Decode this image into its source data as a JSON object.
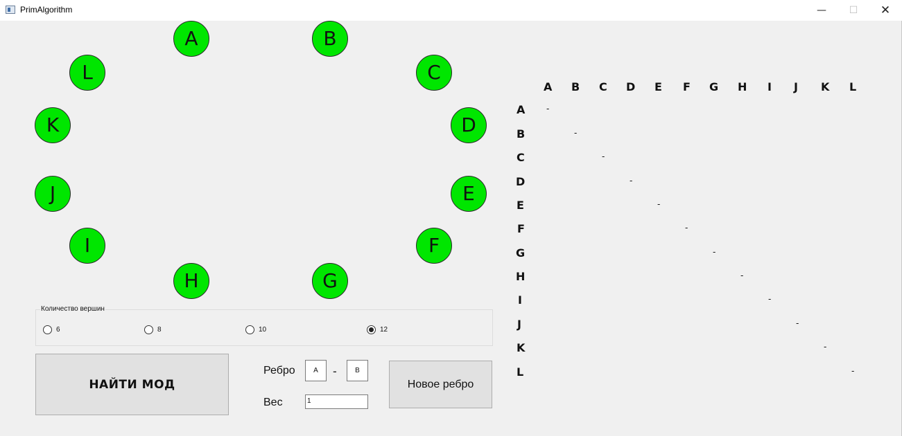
{
  "window": {
    "title": "PrimAlgorithm",
    "controls": {
      "minimize": "—",
      "maximize": "☐",
      "close": "✕"
    }
  },
  "graph": {
    "node_color": "#00e600",
    "nodes": [
      "A",
      "B",
      "C",
      "D",
      "E",
      "F",
      "G",
      "H",
      "I",
      "J",
      "K",
      "L"
    ]
  },
  "matrix": {
    "columns": [
      "A",
      "B",
      "C",
      "D",
      "E",
      "F",
      "G",
      "H",
      "I",
      "J",
      "K",
      "L"
    ],
    "rows": [
      "A",
      "B",
      "C",
      "D",
      "E",
      "F",
      "G",
      "H",
      "I",
      "J",
      "K",
      "L"
    ],
    "diagonal_value": "-"
  },
  "vertex_count": {
    "label": "Количество вершин",
    "options": [
      "6",
      "8",
      "10",
      "12"
    ],
    "selected": "12"
  },
  "actions": {
    "find_label": "НАЙТИ МОД",
    "new_edge_label": "Новое ребро"
  },
  "edge": {
    "label": "Ребро",
    "from": "A",
    "separator": "-",
    "to": "B"
  },
  "weight": {
    "label": "Вес",
    "value": "1"
  }
}
